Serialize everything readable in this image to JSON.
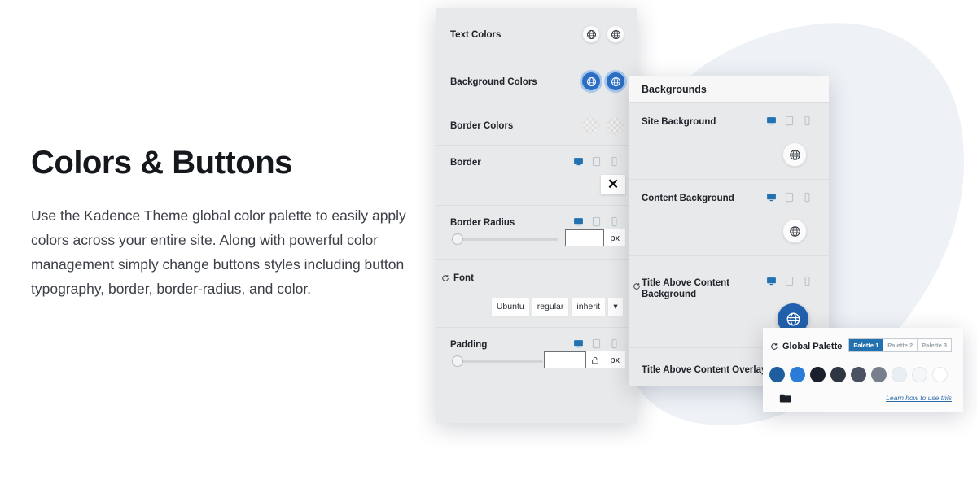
{
  "copy": {
    "heading": "Colors & Buttons",
    "body": "Use the Kadence Theme global color palette to easily apply colors across your entire site. Along with powerful color management simply change buttons styles including button typography, border, border-radius, and color."
  },
  "style_panel": {
    "rows": [
      {
        "label": "Text Colors",
        "type": "swatch-pair",
        "swatch_style": "plain"
      },
      {
        "label": "Background Colors",
        "type": "swatch-pair",
        "swatch_style": "blue"
      },
      {
        "label": "Border Colors",
        "type": "swatch-pair",
        "swatch_style": "checker"
      },
      {
        "label": "Border",
        "type": "device-only"
      },
      {
        "label": "Border Radius",
        "type": "slider",
        "value": "",
        "unit": "px"
      },
      {
        "label": "Font",
        "type": "font",
        "reset": true
      },
      {
        "label": "Padding",
        "type": "slider-lock",
        "value": "",
        "unit": "px"
      }
    ],
    "font_chips": [
      "Ubuntu",
      "regular",
      "inherit"
    ],
    "font_dropdown_glyph": "▾",
    "close_glyph": "✕",
    "devices": [
      "desktop-icon",
      "tablet-icon",
      "mobile-icon"
    ],
    "active_device": "desktop-icon"
  },
  "backgrounds_panel": {
    "title": "Backgrounds",
    "rows": [
      {
        "label": "Site Background",
        "reset": false,
        "swatch": "plain"
      },
      {
        "label": "Content Background",
        "reset": false,
        "swatch": "plain"
      },
      {
        "label": "Title Above Content Background",
        "reset": true,
        "swatch": "blue"
      },
      {
        "label": "Title Above Content Overlay",
        "reset": false,
        "swatch": "none"
      }
    ]
  },
  "global_palette": {
    "title": "Global Palette",
    "reset_icon": "reset-icon",
    "tabs": [
      {
        "label": "Palette 1",
        "active": true
      },
      {
        "label": "Palette 2",
        "active": false
      },
      {
        "label": "Palette 3",
        "active": false
      }
    ],
    "swatches": [
      "#1f5e9e",
      "#2b7cd9",
      "#1a1f2b",
      "#2e3643",
      "#4a5261",
      "#78808d",
      "#e8eef3",
      "#f5f7f9",
      "#ffffff"
    ],
    "folder_icon": "folder-icon",
    "link_text": "Learn how to use this"
  },
  "decor": {
    "blob_color": "#eef2f6"
  }
}
